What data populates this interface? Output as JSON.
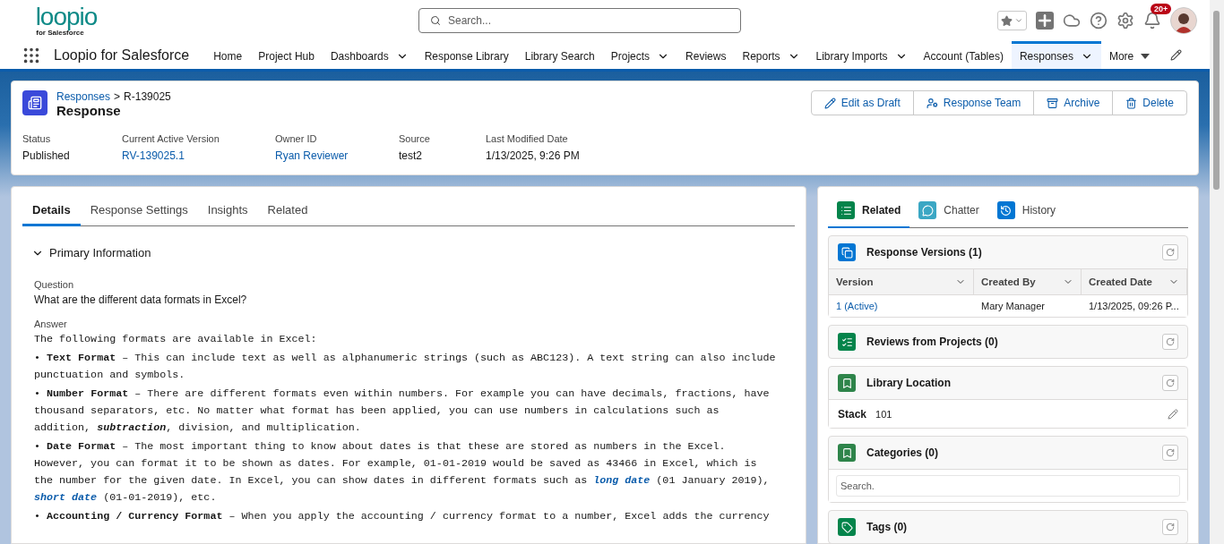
{
  "app": {
    "logo": "loopio",
    "logo_sub": "for Salesforce",
    "name": "Loopio for Salesforce"
  },
  "search": {
    "placeholder": "Search..."
  },
  "notifications": {
    "badge": "20+"
  },
  "nav": [
    {
      "label": "Home",
      "kind": "plain",
      "selected": false
    },
    {
      "label": "Project Hub",
      "kind": "plain",
      "selected": false
    },
    {
      "label": "Dashboards",
      "kind": "dropdown",
      "selected": false
    },
    {
      "label": "Response Library",
      "kind": "plain",
      "selected": false
    },
    {
      "label": "Library Search",
      "kind": "plain",
      "selected": false
    },
    {
      "label": "Projects",
      "kind": "dropdown",
      "selected": false
    },
    {
      "label": "Reviews",
      "kind": "plain",
      "selected": false
    },
    {
      "label": "Reports",
      "kind": "dropdown",
      "selected": false
    },
    {
      "label": "Library Imports",
      "kind": "dropdown",
      "selected": false
    },
    {
      "label": "Account (Tables)",
      "kind": "plain",
      "selected": false
    },
    {
      "label": "Responses",
      "kind": "dropdown",
      "selected": true
    },
    {
      "label": "More",
      "kind": "more",
      "selected": false
    }
  ],
  "record": {
    "breadcrumb_parent": "Responses",
    "breadcrumb_sep": ">",
    "breadcrumb_id": "R-139025",
    "title": "Response",
    "actions": [
      "Edit as Draft",
      "Response Team",
      "Archive",
      "Delete"
    ],
    "fields": [
      {
        "label": "Status",
        "value": "Published",
        "link": false
      },
      {
        "label": "Current Active Version",
        "value": "RV-139025.1",
        "link": true
      },
      {
        "label": "Owner ID",
        "value": "Ryan Reviewer",
        "link": true
      },
      {
        "label": "Source",
        "value": "test2",
        "link": false
      },
      {
        "label": "Last Modified Date",
        "value": "1/13/2025, 9:26 PM",
        "link": false
      }
    ]
  },
  "detail_tabs": [
    {
      "label": "Details",
      "selected": true
    },
    {
      "label": "Response Settings",
      "selected": false
    },
    {
      "label": "Insights",
      "selected": false
    },
    {
      "label": "Related",
      "selected": false
    }
  ],
  "section": {
    "title": "Primary Information",
    "expanded": true
  },
  "question": {
    "label": "Question",
    "value": "What are the different data formats in Excel?"
  },
  "answer": {
    "label": "Answer",
    "paragraphs": [
      [
        {
          "kind": "text",
          "text": "The following formats are available in Excel:"
        }
      ],
      [
        {
          "kind": "text",
          "text": "• "
        },
        {
          "kind": "bold",
          "text": "Text Format"
        },
        {
          "kind": "text",
          "text": " – This can include text as well as alphanumeric strings (such as ABC123). A text string can also include punctuation and symbols."
        }
      ],
      [
        {
          "kind": "text",
          "text": "• "
        },
        {
          "kind": "bold",
          "text": "Number Format"
        },
        {
          "kind": "text",
          "text": " – There are different formats even within numbers. For example you can have decimals, fractions, have thousand separators, etc. No matter what format has been applied, you can use numbers in calculations such as addition, "
        },
        {
          "kind": "italic",
          "text": "subtraction"
        },
        {
          "kind": "text",
          "text": ", division, and multiplication."
        }
      ],
      [
        {
          "kind": "text",
          "text": "• "
        },
        {
          "kind": "bold",
          "text": "Date Format"
        },
        {
          "kind": "text",
          "text": " – The most important thing to know about dates is that these are stored as numbers in the Excel. However, you can format it to be shown as dates. For example, 01-01-2019 would be saved as 43466 in Excel, which is the number for the given date. In Excel, you can show dates in different formats such as "
        },
        {
          "kind": "link",
          "text": "long date"
        },
        {
          "kind": "text",
          "text": " (01 January 2019), "
        },
        {
          "kind": "link",
          "text": "short date"
        },
        {
          "kind": "text",
          "text": " (01-01-2019), etc."
        }
      ],
      [
        {
          "kind": "text",
          "text": "• "
        },
        {
          "kind": "bold",
          "text": "Accounting / Currency Format"
        },
        {
          "kind": "text",
          "text": " – When you apply the accounting / currency format to a number, Excel adds the currency"
        }
      ]
    ]
  },
  "side_tabs": [
    {
      "label": "Related",
      "color": "#04844b",
      "selected": true
    },
    {
      "label": "Chatter",
      "color": "#3ba7c4",
      "selected": false
    },
    {
      "label": "History",
      "color": "#0176d3",
      "selected": false
    }
  ],
  "related": [
    {
      "kind": "table",
      "title": "Response Versions (1)",
      "color": "#0176d3",
      "columns": [
        "Version",
        "Created By",
        "Created Date"
      ],
      "rows": [
        [
          "1 (Active)",
          "Mary Manager",
          "1/13/2025, 09:26 P..."
        ]
      ]
    },
    {
      "kind": "plain",
      "title": "Reviews from Projects (0)",
      "color": "#04844b"
    },
    {
      "kind": "field",
      "title": "Library Location",
      "color": "#2e844a",
      "field_label": "Stack",
      "field_value": "101"
    },
    {
      "kind": "search",
      "title": "Categories (0)",
      "color": "#2e844a",
      "placeholder": "Search."
    },
    {
      "kind": "plain",
      "title": "Tags (0)",
      "color": "#04844b"
    }
  ]
}
